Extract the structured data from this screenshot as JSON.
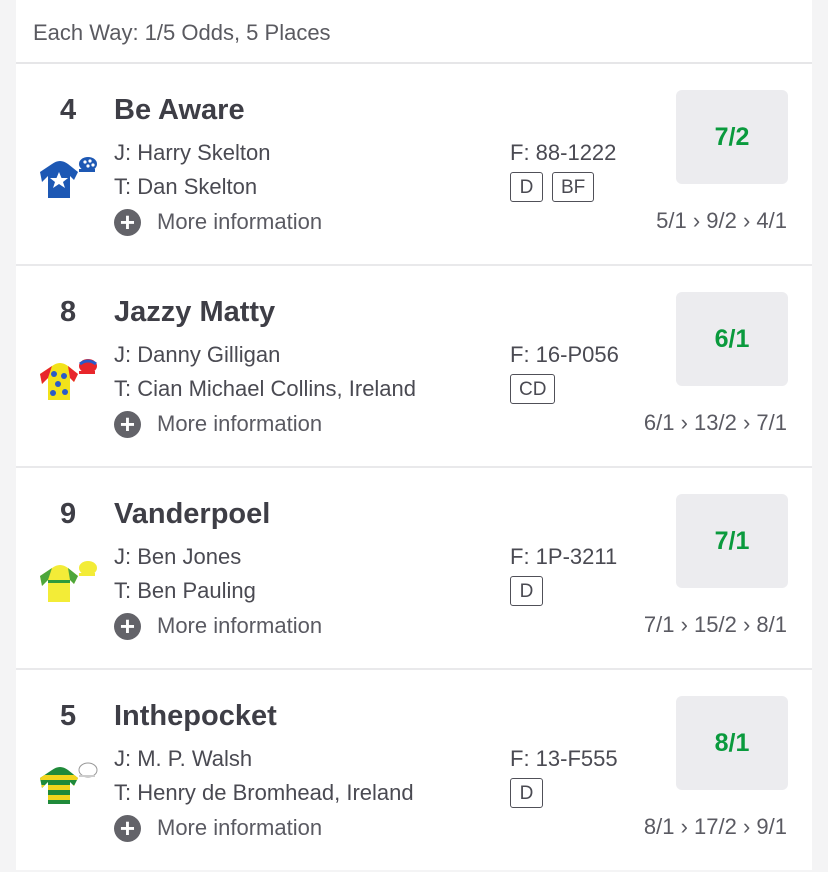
{
  "market": {
    "each_way": "Each Way: 1/5 Odds, 5 Places"
  },
  "colors": {
    "odds_green": "#0a9a3d",
    "button_bg": "#ececef"
  },
  "runners": [
    {
      "number": "4",
      "name": "Be Aware",
      "jockey": "J: Harry Skelton",
      "trainer": "T: Dan Skelton",
      "form": "F: 88-1222",
      "badges": [
        "D",
        "BF"
      ],
      "odds": "7/2",
      "history": "5/1 › 9/2 › 4/1",
      "more": "More information",
      "silk_icon": "silk-blue-white-star-icon"
    },
    {
      "number": "8",
      "name": "Jazzy Matty",
      "jockey": "J: Danny Gilligan",
      "trainer": "T: Cian Michael Collins, Ireland",
      "form": "F: 16-P056",
      "badges": [
        "CD"
      ],
      "odds": "6/1",
      "history": "6/1 › 13/2 › 7/1",
      "more": "More information",
      "silk_icon": "silk-yellow-red-spots-icon"
    },
    {
      "number": "9",
      "name": "Vanderpoel",
      "jockey": "J: Ben Jones",
      "trainer": "T: Ben Pauling",
      "form": "F: 1P-3211",
      "badges": [
        "D"
      ],
      "odds": "7/1",
      "history": "7/1 › 15/2 › 8/1",
      "more": "More information",
      "silk_icon": "silk-yellow-green-icon"
    },
    {
      "number": "5",
      "name": "Inthepocket",
      "jockey": "J: M. P. Walsh",
      "trainer": "T: Henry de Bromhead, Ireland",
      "form": "F: 13-F555",
      "badges": [
        "D"
      ],
      "odds": "8/1",
      "history": "8/1 › 17/2 › 9/1",
      "more": "More information",
      "silk_icon": "silk-green-yellow-hoops-icon"
    }
  ]
}
